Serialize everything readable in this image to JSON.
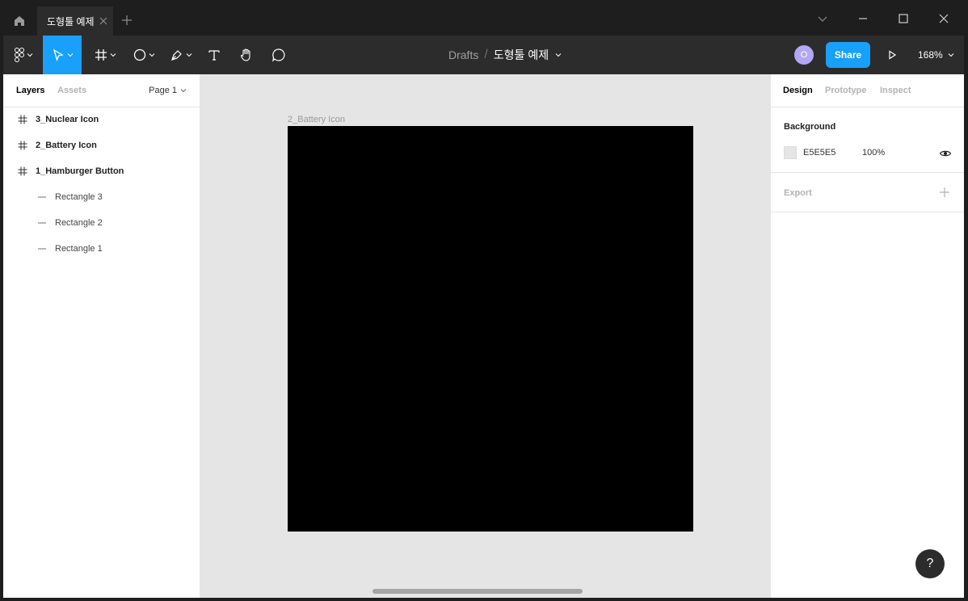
{
  "titlebar": {
    "tab_title": "도형툴 예제"
  },
  "toolbar": {
    "breadcrumb_root": "Drafts",
    "breadcrumb_sep": "/",
    "file_name": "도형툴 예제",
    "avatar_initial": "O",
    "share_label": "Share",
    "zoom_level": "168%"
  },
  "left_panel": {
    "tabs": [
      "Layers",
      "Assets"
    ],
    "page_selector": "Page 1",
    "layers": [
      {
        "name": "3_Nuclear Icon",
        "type": "frame"
      },
      {
        "name": "2_Battery Icon",
        "type": "frame"
      },
      {
        "name": "1_Hamburger Button",
        "type": "frame"
      },
      {
        "name": "Rectangle 3",
        "type": "line"
      },
      {
        "name": "Rectangle 2",
        "type": "line"
      },
      {
        "name": "Rectangle 1",
        "type": "line"
      }
    ]
  },
  "canvas": {
    "frame_label": "2_Battery Icon",
    "frame_fill": "#000000",
    "background": "#E5E5E5"
  },
  "right_panel": {
    "tabs": [
      "Design",
      "Prototype",
      "Inspect"
    ],
    "background_title": "Background",
    "background_hex": "E5E5E5",
    "background_opacity": "100%",
    "export_title": "Export",
    "help_label": "?"
  },
  "colors": {
    "accent": "#18a0fb",
    "toolbar": "#2c2c2c",
    "titlebar": "#1e1e1e",
    "avatar": "#b4a7f5"
  }
}
